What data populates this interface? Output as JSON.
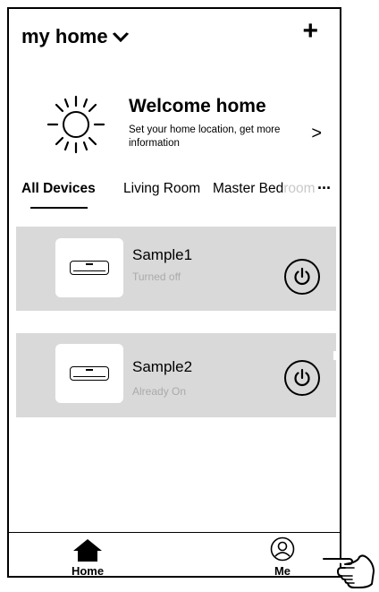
{
  "header": {
    "home_name": "my home",
    "dropdown_icon": "chevron-down-icon",
    "add_label": "+"
  },
  "welcome": {
    "title": "Welcome home",
    "subtitle": "Set your home location, get more information",
    "arrow": ">"
  },
  "tabs": [
    {
      "label": "All Devices",
      "active": true
    },
    {
      "label": "Living Room",
      "active": false
    },
    {
      "label_visible": "Master Bed",
      "label_faded": "room",
      "active": false
    }
  ],
  "tabs_more": "···",
  "devices": [
    {
      "name": "Sample1",
      "status": "Turned off",
      "icon": "air-conditioner-icon"
    },
    {
      "name": "Sample2",
      "status": "Already On",
      "icon": "air-conditioner-icon"
    }
  ],
  "nav": {
    "home_label": "Home",
    "me_label": "Me"
  },
  "colors": {
    "card_bg": "#d9d9d9",
    "status_text": "#aaaaaa",
    "faded_tab": "#c8c8c8"
  }
}
